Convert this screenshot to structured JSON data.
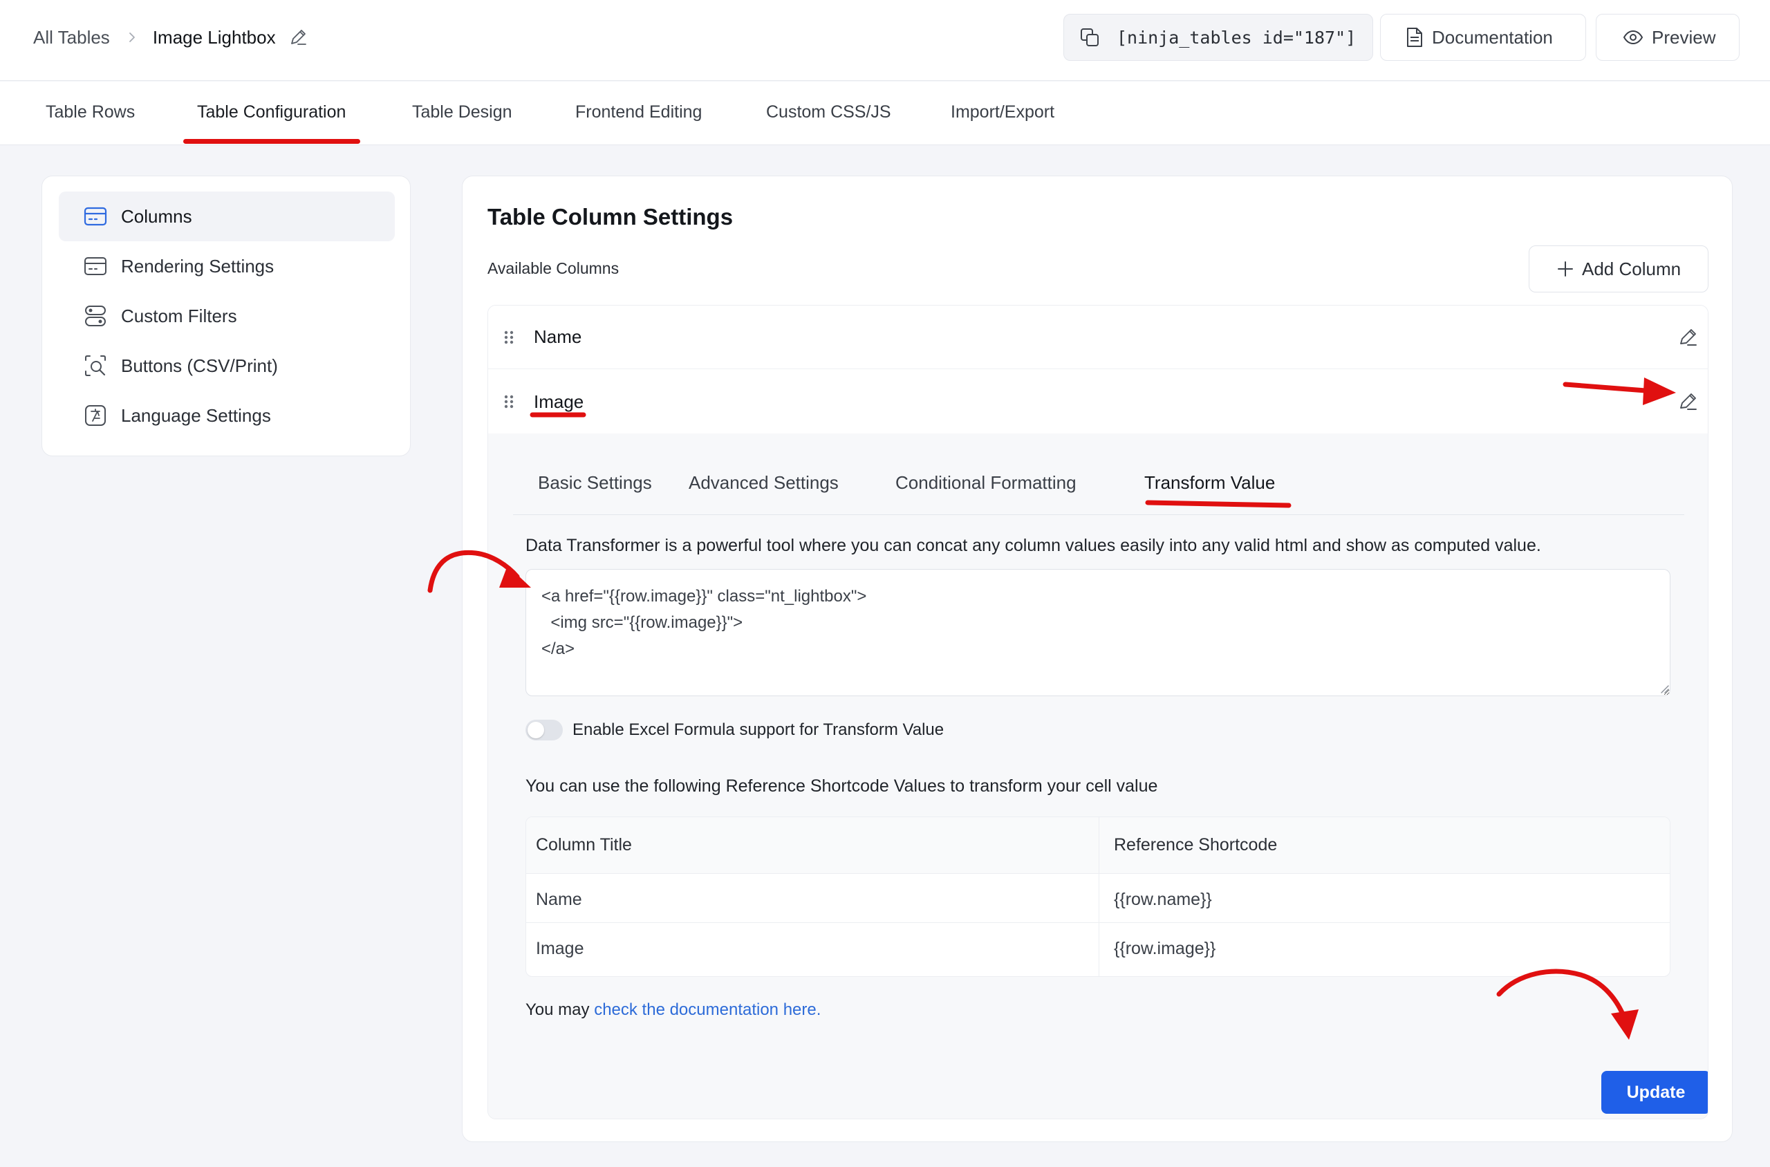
{
  "breadcrumb": {
    "root": "All Tables",
    "current": "Image Lightbox"
  },
  "header": {
    "shortcode": "[ninja_tables id=\"187\"]",
    "documentation": "Documentation",
    "preview": "Preview"
  },
  "tabs": [
    {
      "label": "Table Rows"
    },
    {
      "label": "Table Configuration",
      "active": true
    },
    {
      "label": "Table Design"
    },
    {
      "label": "Frontend Editing"
    },
    {
      "label": "Custom CSS/JS"
    },
    {
      "label": "Import/Export"
    }
  ],
  "sidebar": {
    "items": [
      {
        "label": "Columns",
        "icon": "card-icon",
        "active": true
      },
      {
        "label": "Rendering Settings",
        "icon": "rendering-icon"
      },
      {
        "label": "Custom Filters",
        "icon": "filters-icon"
      },
      {
        "label": "Buttons (CSV/Print)",
        "icon": "search-frame-icon"
      },
      {
        "label": "Language Settings",
        "icon": "language-icon"
      }
    ]
  },
  "main": {
    "title": "Table Column Settings",
    "available_label": "Available Columns",
    "add_column": "Add Column",
    "columns": [
      {
        "name": "Name"
      },
      {
        "name": "Image"
      }
    ],
    "editor": {
      "tabs": [
        {
          "label": "Basic Settings"
        },
        {
          "label": "Advanced Settings"
        },
        {
          "label": "Conditional Formatting"
        },
        {
          "label": "Transform Value",
          "active": true
        }
      ],
      "description": "Data Transformer is a powerful tool where you can concat any column values easily into any valid html and show as computed value.",
      "transform_value": "<a href=\"{{row.image}}\" class=\"nt_lightbox\">\n  <img src=\"{{row.image}}\">\n</a>",
      "excel_toggle_label": "Enable Excel Formula support for Transform Value",
      "excel_toggle_on": false,
      "reference_note": "You can use the following Reference Shortcode Values to transform your cell value",
      "reference_table": {
        "headers": [
          "Column Title",
          "Reference Shortcode"
        ],
        "rows": [
          [
            "Name",
            "{{row.name}}"
          ],
          [
            "Image",
            "{{row.image}}"
          ]
        ]
      },
      "doc_note_prefix": "You may",
      "doc_link": "check the documentation here.",
      "update": "Update"
    }
  },
  "colors": {
    "accent": "#1f5fe8",
    "annotation": "#e01010",
    "link": "#2d6bd8"
  }
}
